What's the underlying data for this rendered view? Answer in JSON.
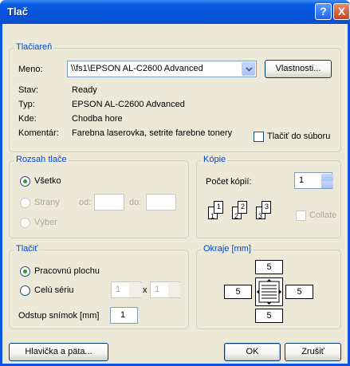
{
  "window": {
    "title": "Tlač",
    "help_label": "?",
    "close_label": "X"
  },
  "printer": {
    "group_label": "Tlačiareň",
    "name_label": "Meno:",
    "name_value": "\\\\fs1\\EPSON AL-C2600 Advanced",
    "properties_label": "Vlastnosti...",
    "status_label": "Stav:",
    "status_value": "Ready",
    "type_label": "Typ:",
    "type_value": "EPSON AL-C2600 Advanced",
    "where_label": "Kde:",
    "where_value": "Chodba hore",
    "comment_label": "Komentár:",
    "comment_value": "Farebna laserovka, setrite farebne tonery",
    "print_to_file_label": "Tlačiť do súboru",
    "print_to_file_checked": false
  },
  "range": {
    "group_label": "Rozsah tlače",
    "all_label": "Všetko",
    "pages_label": "Strany",
    "from_label": "od:",
    "to_label": "do:",
    "selection_label": "Výber",
    "selected": "all"
  },
  "copies": {
    "group_label": "Kópie",
    "count_label": "Počet kópií:",
    "count_value": "1",
    "collate_label": "Collate",
    "collate_checked": false,
    "collate_icons": [
      "1",
      "1",
      "2",
      "2",
      "3",
      "3"
    ]
  },
  "print": {
    "group_label": "Tlačiť",
    "workspace_label": "Pracovnú plochu",
    "series_label": "Celú sériu",
    "series_cols": "1",
    "times_label": "x",
    "series_rows": "1",
    "spacing_label": "Odstup snímok [mm]",
    "spacing_value": "1",
    "selected": "workspace"
  },
  "margins": {
    "group_label": "Okraje [mm]",
    "top": "5",
    "left": "5",
    "right": "5",
    "bottom": "5"
  },
  "footer": {
    "header_footer_label": "Hlavička a päta...",
    "ok_label": "OK",
    "cancel_label": "Zrušiť"
  }
}
